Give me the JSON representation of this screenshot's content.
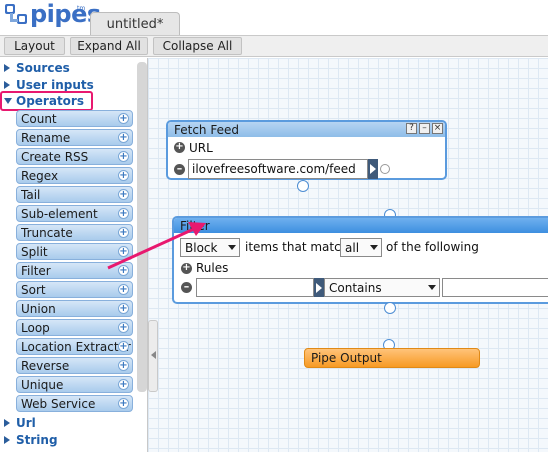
{
  "app": {
    "logo_text": "pipes",
    "logo_tm": "tm",
    "tab_title": "untitled*"
  },
  "toolbar": {
    "layout": "Layout",
    "expand_all": "Expand All",
    "collapse_all": "Collapse All"
  },
  "sidebar": {
    "sections": {
      "sources": "Sources",
      "user_inputs": "User inputs",
      "operators": "Operators",
      "url": "Url",
      "string": "String"
    },
    "operators": [
      "Count",
      "Rename",
      "Create RSS",
      "Regex",
      "Tail",
      "Sub-element",
      "Truncate",
      "Split",
      "Filter",
      "Sort",
      "Union",
      "Loop",
      "Location Extractor",
      "Reverse",
      "Unique",
      "Web Service"
    ]
  },
  "fetch_feed": {
    "title": "Fetch Feed",
    "url_label": "URL",
    "url_value": "ilovefreesoftware.com/feed",
    "buttons": [
      "?",
      "–",
      "×"
    ]
  },
  "filter": {
    "title": "Filter",
    "action_value": "Block",
    "mid_text": "items that match",
    "match_value": "all",
    "end_text": "of the following",
    "rules_label": "Rules",
    "rule_condition": "Contains",
    "rule_field_value": "",
    "rule_value": ""
  },
  "pipe_output": {
    "title": "Pipe Output"
  },
  "colors": {
    "accent_highlight": "#e8196f",
    "module_blue": "#a9cbec",
    "output_orange": "#f79a24"
  }
}
